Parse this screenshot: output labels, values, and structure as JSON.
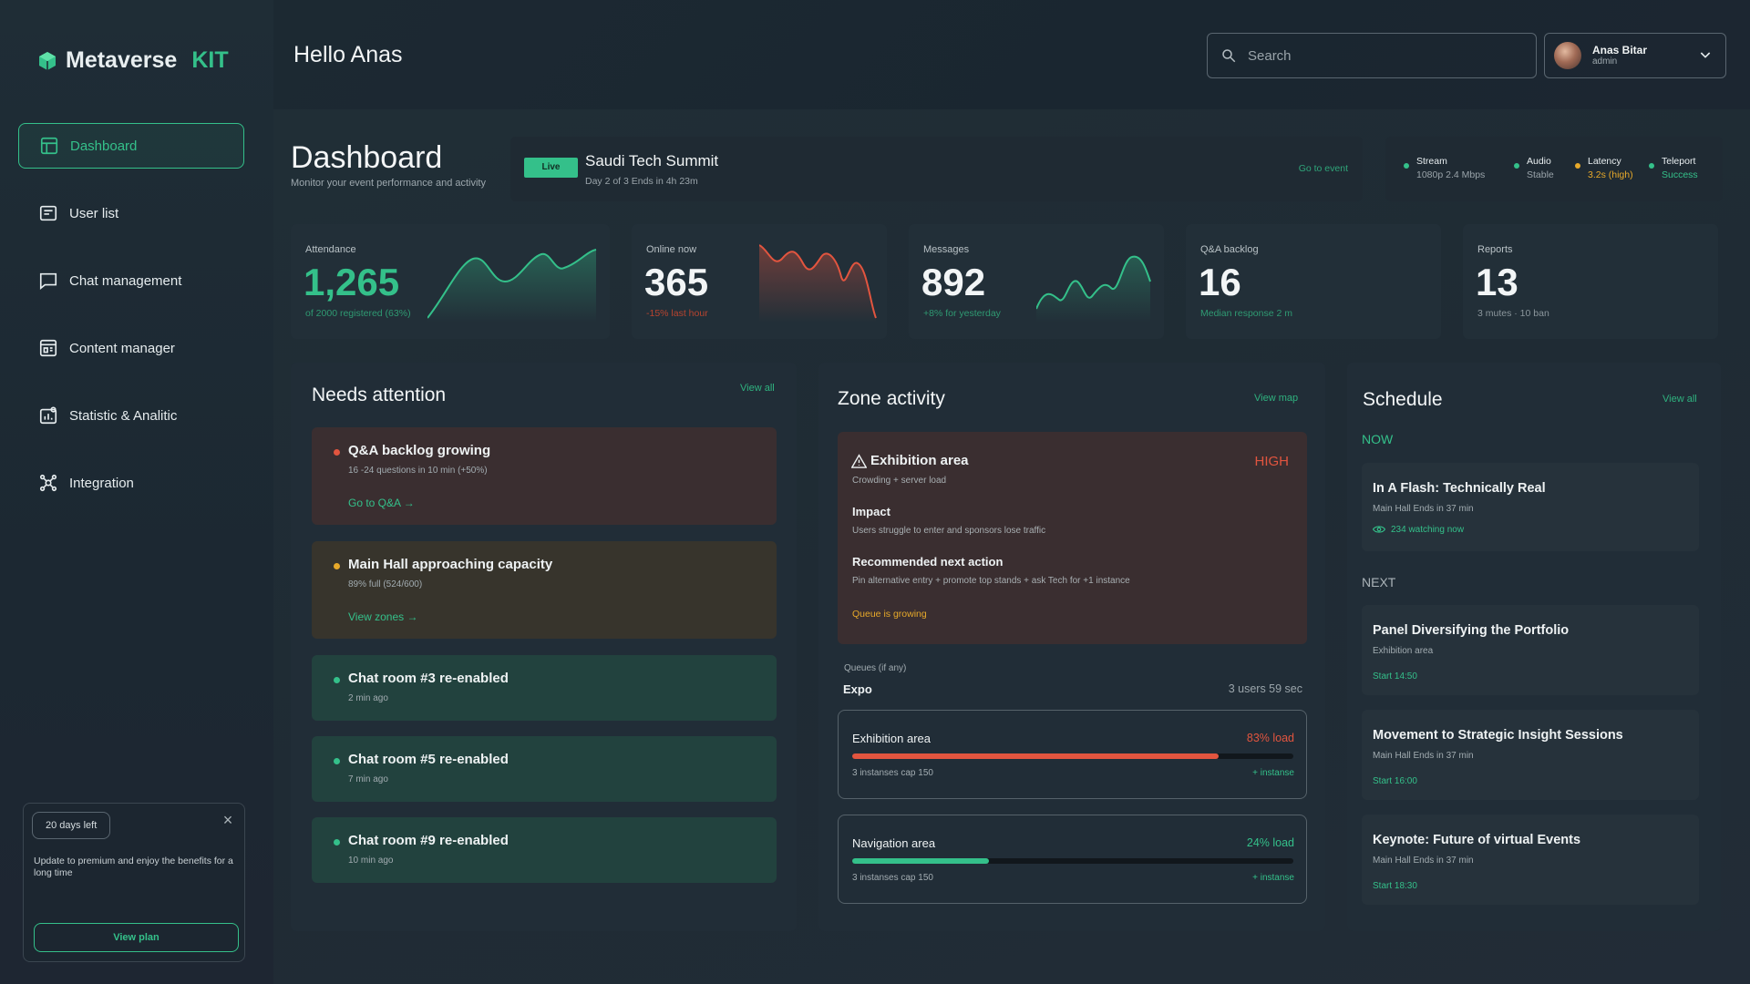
{
  "brand": {
    "name": "Metaverse",
    "suffix": "KIT",
    "accent": "#34c08a"
  },
  "sidebar": {
    "items": [
      {
        "label": "Dashboard",
        "icon": "layout-icon",
        "active": true
      },
      {
        "label": "User list",
        "icon": "list-icon"
      },
      {
        "label": "Chat management",
        "icon": "chat-icon"
      },
      {
        "label": "Content manager",
        "icon": "content-icon"
      },
      {
        "label": "Statistic & Analitic",
        "icon": "stats-icon"
      },
      {
        "label": "Integration",
        "icon": "integration-icon"
      }
    ],
    "promo": {
      "badge": "20 days left",
      "text": "Update to premium and enjoy the benefits for a long time",
      "button": "View plan"
    }
  },
  "header": {
    "greeting": "Hello Anas",
    "search_placeholder": "Search",
    "user": {
      "name": "Anas Bitar",
      "role": "admin"
    }
  },
  "page": {
    "title": "Dashboard",
    "subtitle": "Monitor your event performance and activity"
  },
  "event": {
    "badge": "Live",
    "name": "Saudi Tech Summit",
    "sub": "Day 2 of 3 Ends in 4h 23m",
    "link": "Go to event"
  },
  "status": [
    {
      "label": "Stream",
      "value": "1080p 2.4 Mbps",
      "color": "#34c08a"
    },
    {
      "label": "Audio",
      "value": "Stable",
      "color": "#34c08a"
    },
    {
      "label": "Latency",
      "value": "3.2s (high)",
      "color": "#e7a92a"
    },
    {
      "label": "Teleport",
      "value": "Success",
      "color": "#34c08a"
    }
  ],
  "kpis": [
    {
      "label": "Attendance",
      "value": "1,265",
      "sub": "of 2000 registered (63%)",
      "color": "#34c08a"
    },
    {
      "label": "Online now",
      "value": "365",
      "sub": "-15% last hour",
      "color": "#e2553f"
    },
    {
      "label": "Messages",
      "value": "892",
      "sub": "+8% for yesterday",
      "color": "#34c08a"
    },
    {
      "label": "Q&A backlog",
      "value": "16",
      "sub": "Median response 2 m",
      "color": "#34c08a"
    },
    {
      "label": "Reports",
      "value": "13",
      "sub": "3 mutes · 10 ban",
      "color": "#8b969c"
    }
  ],
  "attention": {
    "title": "Needs attention",
    "link": "View all",
    "items": [
      {
        "title": "Q&A backlog growing",
        "sub": "16 -24 questions in 10 min (+50%)",
        "action": "Go to Q&A →",
        "color": "#e2553f",
        "bg": "#3a2e30"
      },
      {
        "title": "Main Hall approaching capacity",
        "sub": "89% full (524/600)",
        "action": "View zones →",
        "color": "#e7a92a",
        "bg": "#37342c"
      },
      {
        "title": "Chat room #3 re-enabled",
        "sub": "2 min ago",
        "color": "#34c08a",
        "bg": "#22423e"
      },
      {
        "title": "Chat room #5 re-enabled",
        "sub": "7 min ago",
        "color": "#34c08a",
        "bg": "#22423e"
      },
      {
        "title": "Chat room #9 re-enabled",
        "sub": "10 min ago",
        "color": "#34c08a",
        "bg": "#22423e"
      }
    ]
  },
  "zone": {
    "title": "Zone activity",
    "link": "View map",
    "alert": {
      "title": "Exhibition area",
      "level": "HIGH",
      "sub": "Crowding + server load",
      "impact_label": "Impact",
      "impact": "Users struggle to enter and sponsors lose traffic",
      "action_label": "Recommended next action",
      "action": "Pin alternative entry + promote top stands + ask Tech for +1 instance",
      "queue_note": "Queue is growing"
    },
    "queue_label": "Queues (if any)",
    "queue_name": "Expo",
    "queue_value": "3 users 59 sec",
    "zones": [
      {
        "name": "Exhibition area",
        "load": "83% load",
        "fraction": 0.83,
        "color": "#e2553f",
        "sub": "3 instanses cap 150",
        "add": "+ instanse"
      },
      {
        "name": "Navigation area",
        "load": "24% load",
        "fraction": 0.31,
        "color": "#34c08a",
        "sub": "3 instanses cap 150",
        "add": "+ instanse"
      }
    ]
  },
  "schedule": {
    "title": "Schedule",
    "link": "View all",
    "now_label": "NOW",
    "next_label": "NEXT",
    "now": {
      "title": "In A Flash: Technically Real",
      "sub": "Main Hall Ends in 37 min",
      "watching": "234 watching now"
    },
    "next": [
      {
        "title": "Panel Diversifying the Portfolio",
        "sub": "Exhibition area",
        "start": "Start 14:50"
      },
      {
        "title": "Movement to Strategic Insight Sessions",
        "sub": "Main Hall Ends in 37 min",
        "start": "Start 16:00"
      },
      {
        "title": "Keynote: Future of virtual Events",
        "sub": "Main Hall Ends in 37 min",
        "start": "Start 18:30"
      }
    ]
  }
}
